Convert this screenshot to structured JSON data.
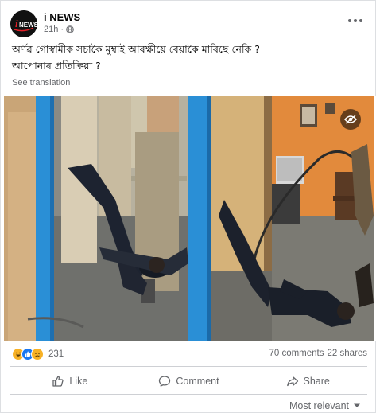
{
  "post": {
    "page_name": "i NEWS",
    "avatar_logo_text": "i NEWS",
    "time": "21h",
    "separator": "·",
    "text_line_1": "অর্ণৱ গোস্বামীক সচাকৈ মুম্বাই আৰক্ষীয়ে বেয়াকৈ মাৰিছে নেকি ?",
    "text_line_2": "আপোনাৰ প্ৰতিক্ৰিয়া ?",
    "see_translation": "See translation"
  },
  "stats": {
    "reaction_count": "231",
    "comments": "70 comments",
    "shares": "22 shares"
  },
  "actions": {
    "like": "Like",
    "comment": "Comment",
    "share": "Share"
  },
  "sort": {
    "label": "Most relevant"
  },
  "colors": {
    "secondary_text": "#65676b",
    "brand_red": "#e41e26",
    "like_blue": "#1877f2",
    "haha_yellow": "#f7b125"
  },
  "icons": [
    "globe-icon",
    "more-icon",
    "eye-icon",
    "haha-icon",
    "like-reaction-icon",
    "sad-icon",
    "like-icon",
    "comment-icon",
    "share-icon",
    "chevron-down-icon"
  ]
}
